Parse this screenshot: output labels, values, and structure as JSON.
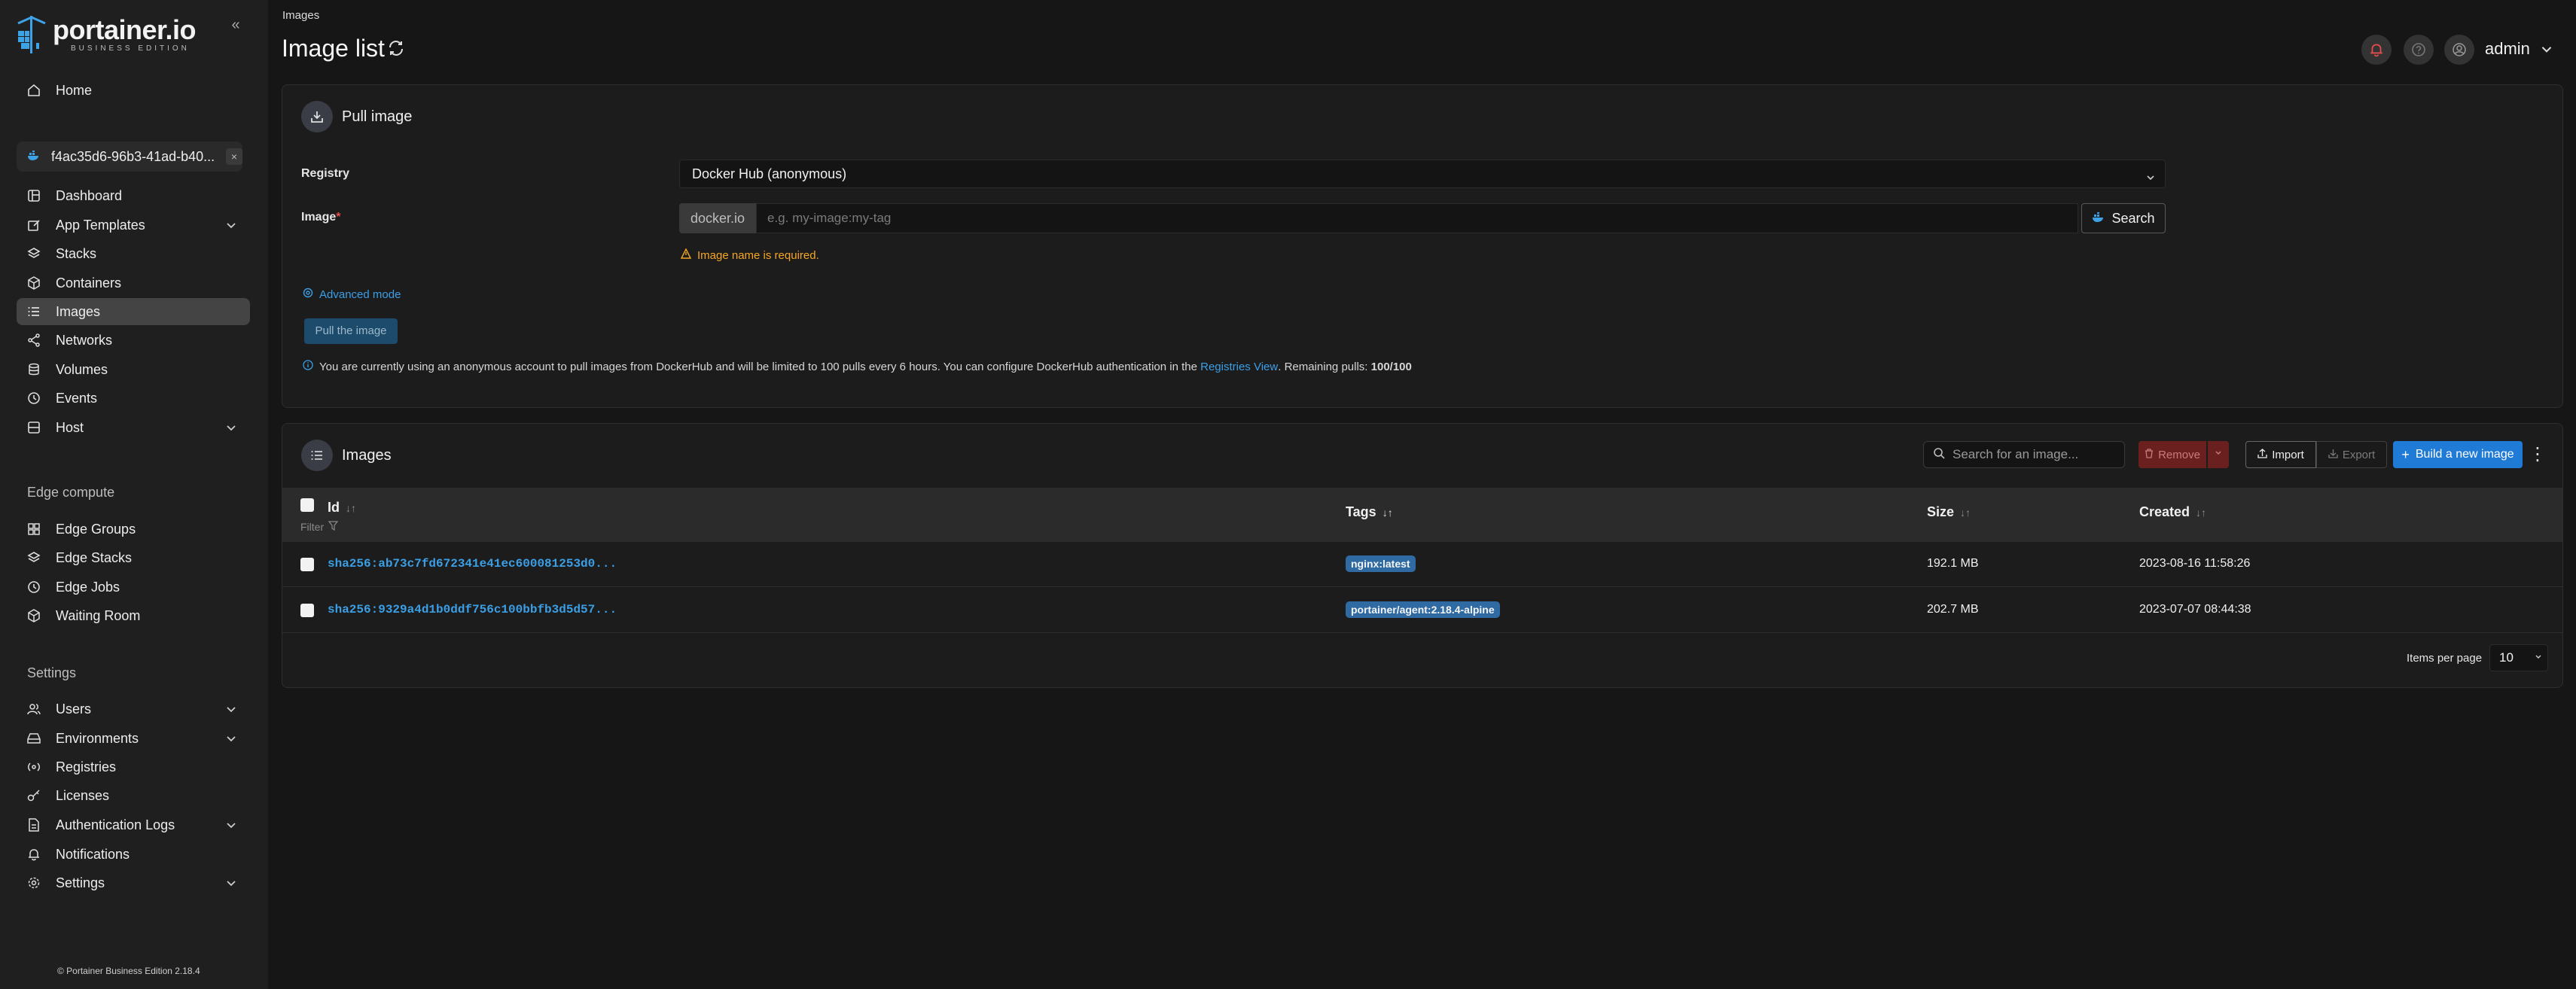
{
  "sidebar": {
    "logo_title": "portainer.io",
    "logo_subtitle": "BUSINESS EDITION",
    "home": "Home",
    "environment_name": "f4ac35d6-96b3-41ad-b40...",
    "env_items": [
      {
        "label": "Dashboard"
      },
      {
        "label": "App Templates"
      },
      {
        "label": "Stacks"
      },
      {
        "label": "Containers"
      },
      {
        "label": "Images"
      },
      {
        "label": "Networks"
      },
      {
        "label": "Volumes"
      },
      {
        "label": "Events"
      },
      {
        "label": "Host"
      }
    ],
    "edge_title": "Edge compute",
    "edge_items": [
      {
        "label": "Edge Groups"
      },
      {
        "label": "Edge Stacks"
      },
      {
        "label": "Edge Jobs"
      },
      {
        "label": "Waiting Room"
      }
    ],
    "settings_title": "Settings",
    "settings_items": [
      {
        "label": "Users"
      },
      {
        "label": "Environments"
      },
      {
        "label": "Registries"
      },
      {
        "label": "Licenses"
      },
      {
        "label": "Authentication Logs"
      },
      {
        "label": "Notifications"
      },
      {
        "label": "Settings"
      }
    ],
    "footer": "© Portainer Business Edition 2.18.4"
  },
  "header": {
    "breadcrumb": "Images",
    "title": "Image list",
    "user": "admin"
  },
  "pull": {
    "title": "Pull image",
    "registry_label": "Registry",
    "registry_value": "Docker Hub (anonymous)",
    "image_label": "Image",
    "required_mark": "*",
    "prefix": "docker.io",
    "placeholder": "e.g. my-image:my-tag",
    "search_btn": "Search",
    "warning": "Image name is required.",
    "advanced": "Advanced mode",
    "pull_btn": "Pull the image",
    "info_pre": "You are currently using an anonymous account to pull images from DockerHub and will be limited to 100 pulls every 6 hours. You can configure DockerHub authentication in the",
    "info_link": "Registries View",
    "info_post": ". Remaining pulls:",
    "remaining": "100/100"
  },
  "images": {
    "title": "Images",
    "search_placeholder": "Search for an image...",
    "remove": "Remove",
    "import": "Import",
    "export": "Export",
    "build": "Build a new image",
    "columns": {
      "id": "Id",
      "filter": "Filter",
      "tags": "Tags",
      "size": "Size",
      "created": "Created"
    },
    "rows": [
      {
        "id": "sha256:ab73c7fd672341e41ec600081253d0...",
        "tag": "nginx:latest",
        "size": "192.1 MB",
        "created": "2023-08-16 11:58:26"
      },
      {
        "id": "sha256:9329a4d1b0ddf756c100bbfb3d5d57...",
        "tag": "portainer/agent:2.18.4-alpine",
        "size": "202.7 MB",
        "created": "2023-07-07 08:44:38"
      }
    ],
    "items_per_page_label": "Items per page",
    "items_per_page": "10"
  },
  "colors": {
    "accent": "#1f7bd6",
    "link": "#3b9fe6",
    "warning": "#f5a623",
    "danger": "#6b2020"
  }
}
